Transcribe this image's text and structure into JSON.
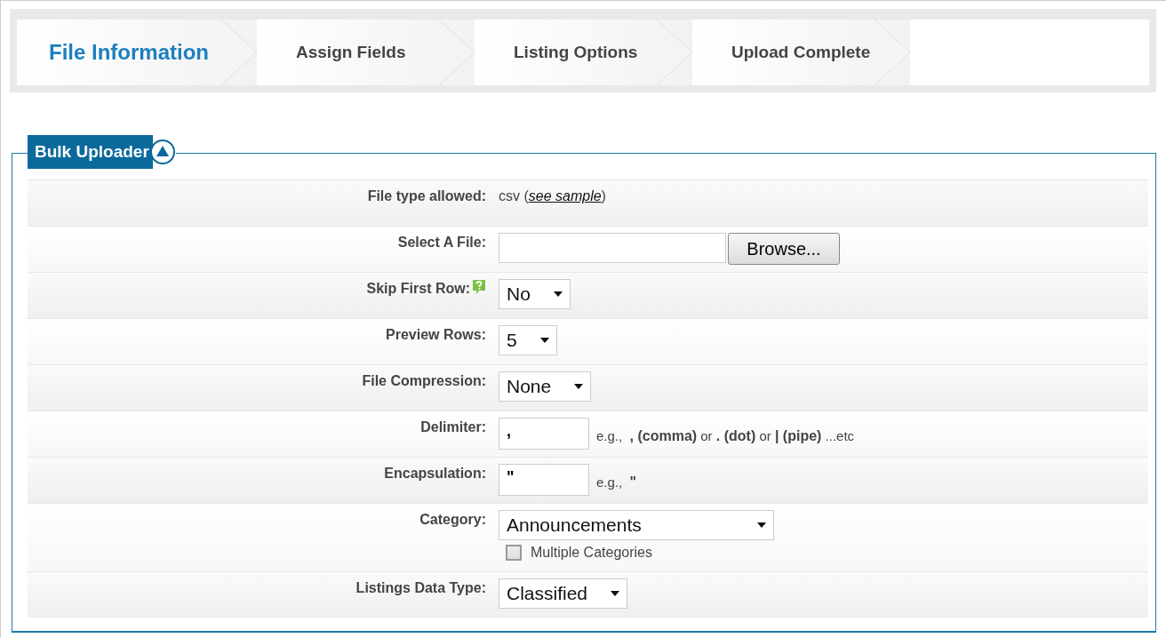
{
  "steps": [
    {
      "label": "File Information",
      "selected": true
    },
    {
      "label": "Assign Fields",
      "selected": false
    },
    {
      "label": "Listing Options",
      "selected": false
    },
    {
      "label": "Upload Complete",
      "selected": false
    }
  ],
  "panel": {
    "title": "Bulk Uploader",
    "expanded": true
  },
  "rows": [
    {
      "kind": "text",
      "label": "File type allowed:",
      "prefix": "csv (",
      "link": "see sample",
      "suffix": ")"
    },
    {
      "kind": "file",
      "label": "Select A File:",
      "button": "Browse..."
    },
    {
      "kind": "select",
      "label": "Skip First Row:",
      "help": true,
      "value": "No"
    },
    {
      "kind": "select",
      "label": "Preview Rows:",
      "help": false,
      "value": "5"
    },
    {
      "kind": "select",
      "label": "File Compression:",
      "help": false,
      "value": "None"
    },
    {
      "kind": "input",
      "label": "Delimiter:",
      "value": ",",
      "hint": "e.g.,  **, (comma)** or **. (dot)** or **| (pipe)** ...etc"
    },
    {
      "kind": "input",
      "label": "Encapsulation:",
      "value": "\"",
      "hint": "e.g.,  **\"**"
    },
    {
      "kind": "select",
      "label": "Category:",
      "help": false,
      "value": "Announcements",
      "option": {
        "label": "Multiple Categories",
        "checked": false
      }
    },
    {
      "kind": "select",
      "label": "Listings Data Type:",
      "help": false,
      "value": "Classified"
    }
  ]
}
